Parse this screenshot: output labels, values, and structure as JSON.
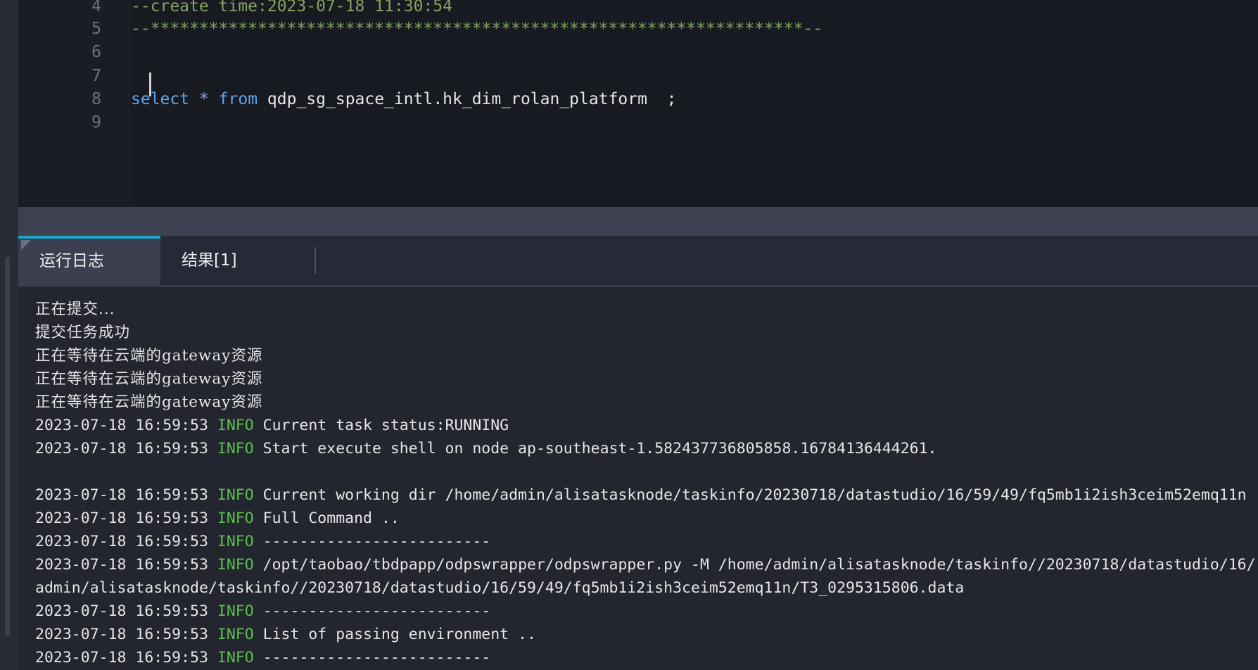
{
  "editor": {
    "lines": [
      {
        "no": "4",
        "text": "--create time:2023-07-18 11:30:54",
        "kind": "comment"
      },
      {
        "no": "5",
        "text": "--*******************************************************************--",
        "kind": "comment"
      },
      {
        "no": "6",
        "text": "",
        "kind": "blank"
      },
      {
        "no": "7",
        "text": "",
        "kind": "blank"
      },
      {
        "no": "8",
        "kind": "sql",
        "kw_select": "select",
        "star": "*",
        "kw_from": "from",
        "table": "qdp_sg_space_intl.hk_dim_rolan_platform",
        "end": "  ;"
      },
      {
        "no": "9",
        "text": "",
        "kind": "blank"
      }
    ]
  },
  "tabs": [
    {
      "label": "运行日志",
      "active": true
    },
    {
      "label": "结果[1]",
      "active": false
    }
  ],
  "log": {
    "level_color": "#58c24a",
    "lines": [
      {
        "text": "正在提交..."
      },
      {
        "text": "提交任务成功"
      },
      {
        "text": "正在等待在云端的gateway资源"
      },
      {
        "text": "正在等待在云端的gateway资源"
      },
      {
        "text": "正在等待在云端的gateway资源"
      },
      {
        "ts": "2023-07-18 16:59:53",
        "level": "INFO",
        "msg": "Current task status:RUNNING"
      },
      {
        "ts": "2023-07-18 16:59:53",
        "level": "INFO",
        "msg": "Start execute shell on node ap-southeast-1.582437736805858.16784136444261."
      },
      {
        "text": ""
      },
      {
        "ts": "2023-07-18 16:59:53",
        "level": "INFO",
        "msg": "Current working dir /home/admin/alisatasknode/taskinfo/20230718/datastudio/16/59/49/fq5mb1i2ish3ceim52emq11n"
      },
      {
        "ts": "2023-07-18 16:59:53",
        "level": "INFO",
        "msg": "Full Command .."
      },
      {
        "ts": "2023-07-18 16:59:53",
        "level": "INFO",
        "msg": "-------------------------"
      },
      {
        "ts": "2023-07-18 16:59:53",
        "level": "INFO",
        "msg": "/opt/taobao/tbdpapp/odpswrapper/odpswrapper.py -M /home/admin/alisatasknode/taskinfo//20230718/datastudio/16/"
      },
      {
        "text": "admin/alisatasknode/taskinfo//20230718/datastudio/16/59/49/fq5mb1i2ish3ceim52emq11n/T3_0295315806.data"
      },
      {
        "ts": "2023-07-18 16:59:53",
        "level": "INFO",
        "msg": "-------------------------"
      },
      {
        "ts": "2023-07-18 16:59:53",
        "level": "INFO",
        "msg": "List of passing environment .."
      },
      {
        "ts": "2023-07-18 16:59:53",
        "level": "INFO",
        "msg": "-------------------------"
      }
    ]
  }
}
